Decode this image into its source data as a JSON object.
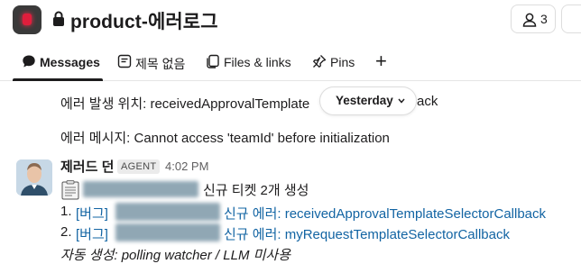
{
  "header": {
    "channel_name": "product-에러로그",
    "member_count": "3"
  },
  "tabs": [
    {
      "label": "Messages",
      "icon": "message-bubble-icon",
      "active": true
    },
    {
      "label": "제목 없음",
      "icon": "canvas-doc-icon",
      "active": false
    },
    {
      "label": "Files & links",
      "icon": "files-icon",
      "active": false
    },
    {
      "label": "Pins",
      "icon": "pin-icon",
      "active": false
    }
  ],
  "add_tab_label": "+",
  "messages": {
    "line1": "에러 발생 위치: receivedApprovalTemplate",
    "line1_tail": "ack",
    "line2": "에러 메시지: Cannot access 'teamId' before initialization"
  },
  "date_divider": "Yesterday",
  "post": {
    "sender": "제러드 던",
    "badge": "AGENT",
    "time": "4:02 PM",
    "summary": "신규 티켓 2개 생성",
    "items": [
      {
        "num": "1.",
        "tag": "[버그]",
        "text": "신규 에러: receivedApprovalTemplateSelectorCallback"
      },
      {
        "num": "2.",
        "tag": "[버그]",
        "text": "신규 에러: myRequestTemplateSelectorCallback"
      }
    ],
    "footer": "자동 생성: polling watcher / LLM 미사용"
  },
  "colors": {
    "text": "#1d1c1d",
    "link": "#1264a3",
    "muted": "#616061",
    "app_icon_accent": "#e01e3c"
  }
}
